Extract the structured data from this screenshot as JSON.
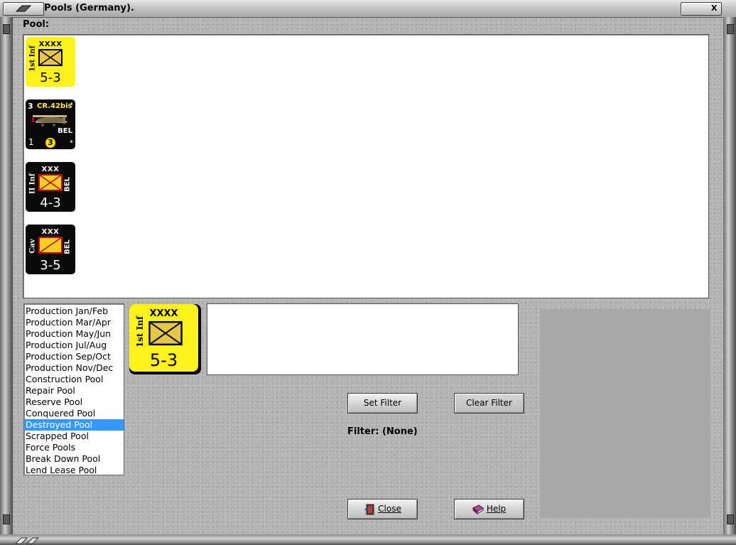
{
  "window": {
    "title": "Pools (Germany).",
    "close_label": "X"
  },
  "pool": {
    "label": "Pool:",
    "units": [
      {
        "type": "land",
        "style": "yellow",
        "size": "XXXX",
        "name": "1st Inf",
        "nation": "",
        "strength": "5-3"
      },
      {
        "type": "air",
        "style": "black",
        "top_left": "3",
        "name": "CR.42bis",
        "nation": "BEL",
        "bottom_left": "1",
        "circle": "3",
        "star": "*"
      },
      {
        "type": "land",
        "style": "black",
        "size": "XXX",
        "name": "II Inf",
        "nation": "BEL",
        "strength": "4-3"
      },
      {
        "type": "land",
        "style": "black",
        "size": "XXX",
        "name": "Cav",
        "nation": "BEL",
        "strength": "3-5"
      }
    ]
  },
  "pool_list": {
    "items": [
      "Production Jan/Feb",
      "Production Mar/Apr",
      "Production May/Jun",
      "Production Jul/Aug",
      "Production Sep/Oct",
      "Production Nov/Dec",
      "Construction Pool",
      "Repair Pool",
      "Reserve Pool",
      "Conquered Pool",
      "Destroyed Pool",
      "Scrapped Pool",
      "Force Pools",
      "Break Down Pool",
      "Lend Lease Pool"
    ],
    "selected": "Destroyed Pool"
  },
  "selected_unit": {
    "size": "XXXX",
    "name": "1st Inf",
    "strength": "5-3"
  },
  "buttons": {
    "set_filter": "Set Filter",
    "clear_filter": "Clear Filter",
    "close": "Close",
    "help": "Help"
  },
  "filter": {
    "text": "Filter: (None)"
  },
  "colors": {
    "selection": "#3399ff",
    "counter_yellow": "#fff21a",
    "counter_black": "#0a0a0a"
  }
}
